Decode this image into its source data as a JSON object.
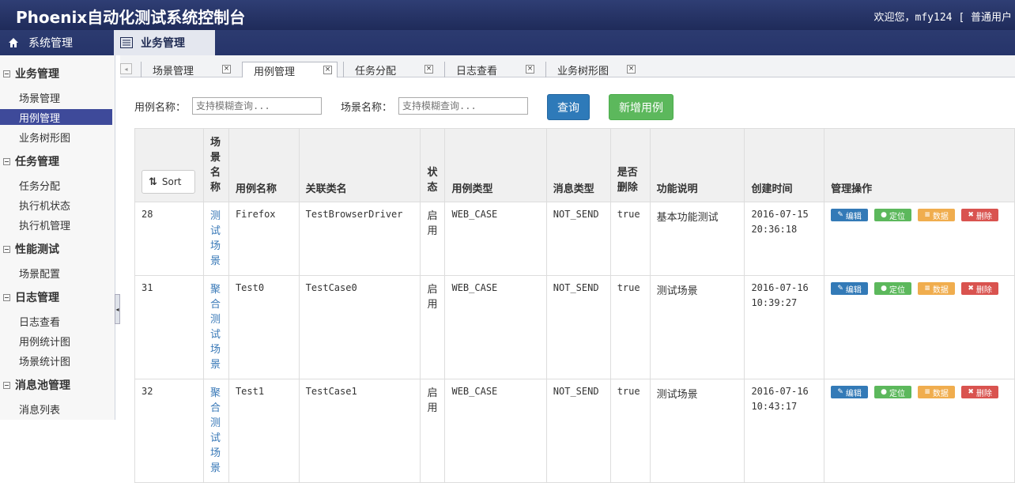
{
  "header": {
    "title": "Phoenix自动化测试系统控制台",
    "welcome": "欢迎您，mfy124 [",
    "role": "普通用户"
  },
  "nav": {
    "system": "系统管理",
    "business": "业务管理"
  },
  "sidebar": {
    "groups": [
      {
        "label": "业务管理",
        "items": [
          "场景管理",
          "用例管理",
          "业务树形图"
        ]
      },
      {
        "label": "任务管理",
        "items": [
          "任务分配",
          "执行机状态",
          "执行机管理"
        ]
      },
      {
        "label": "性能测试",
        "items": [
          "场景配置"
        ]
      },
      {
        "label": "日志管理",
        "items": [
          "日志查看",
          "用例统计图",
          "场景统计图"
        ]
      },
      {
        "label": "消息池管理",
        "items": [
          "消息列表"
        ]
      }
    ],
    "active_item": "用例管理"
  },
  "tabs": [
    "场景管理",
    "用例管理",
    "任务分配",
    "日志查看",
    "业务树形图"
  ],
  "active_tab": "用例管理",
  "search": {
    "case_label": "用例名称：",
    "case_placeholder": "支持模糊查询...",
    "scene_label": "场景名称：",
    "scene_placeholder": "支持模糊查询...",
    "query_button": "查询",
    "add_button": "新增用例"
  },
  "table": {
    "sort_label": "Sort",
    "headers": [
      "场景名称",
      "用例名称",
      "关联类名",
      "状态",
      "用例类型",
      "消息类型",
      "是否删除",
      "功能说明",
      "创建时间",
      "管理操作"
    ],
    "ops": [
      "编辑",
      "定位",
      "数据",
      "删除"
    ],
    "rows": [
      {
        "id": "28",
        "scene": "测试场景",
        "case": "Firefox",
        "cls": "TestBrowserDriver",
        "status": "启用",
        "type": "WEB_CASE",
        "msg": "NOT_SEND",
        "deleted": "true",
        "desc": "基本功能测试",
        "date": "2016-07-15",
        "time": "20:36:18"
      },
      {
        "id": "31",
        "scene": "聚合测试场景",
        "case": "Test0",
        "cls": "TestCase0",
        "status": "启用",
        "type": "WEB_CASE",
        "msg": "NOT_SEND",
        "deleted": "true",
        "desc": "测试场景",
        "date": "2016-07-16",
        "time": "10:39:27"
      },
      {
        "id": "32",
        "scene": "聚合测试场景",
        "case": "Test1",
        "cls": "TestCase1",
        "status": "启用",
        "type": "WEB_CASE",
        "msg": "NOT_SEND",
        "deleted": "true",
        "desc": "测试场景",
        "date": "2016-07-16",
        "time": "10:43:17"
      }
    ]
  },
  "colors": {
    "header": "#26346a",
    "active": "#3e4a9a",
    "link": "#3878b7"
  }
}
